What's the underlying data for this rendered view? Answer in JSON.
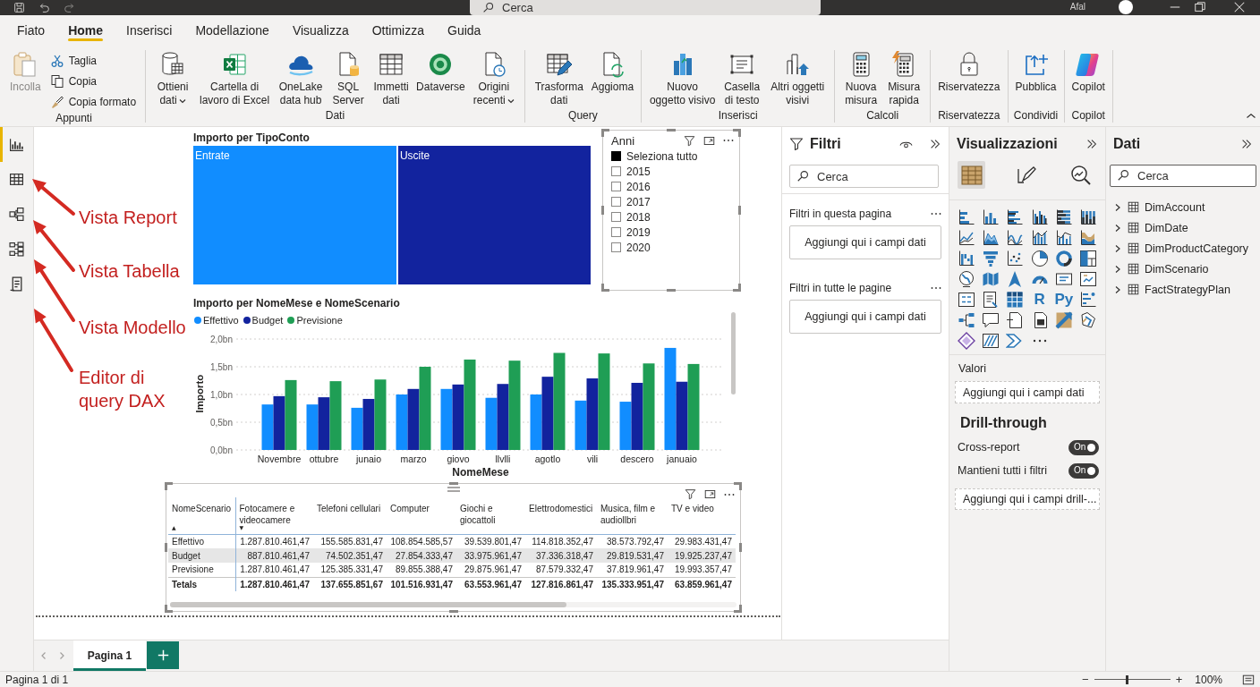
{
  "title_bar": {
    "search_placeholder": "Cerca",
    "user_label": "Afal"
  },
  "menu_tabs": [
    {
      "label": "Fiato",
      "selected": false
    },
    {
      "label": "Home",
      "selected": true
    },
    {
      "label": "Inserisci",
      "selected": false
    },
    {
      "label": "Modellazione",
      "selected": false
    },
    {
      "label": "Visualizza",
      "selected": false
    },
    {
      "label": "Ottimizza",
      "selected": false
    },
    {
      "label": "Guida",
      "selected": false
    }
  ],
  "ribbon": {
    "groups": [
      {
        "label": "Appunti",
        "items": [
          {
            "label": "Incolla",
            "kind": "large",
            "disabled": true
          },
          {
            "label": "Taglia",
            "kind": "small",
            "disabled": false
          },
          {
            "label": "Copia",
            "kind": "small",
            "disabled": false
          },
          {
            "label": "Copia formato",
            "kind": "small",
            "disabled": false
          }
        ]
      },
      {
        "label": "Dati",
        "items": [
          {
            "label": "Ottieni dati",
            "kind": "large",
            "disabled": false,
            "dropdown": true
          },
          {
            "label": "Cartella di lavoro di Excel",
            "kind": "large",
            "disabled": false
          },
          {
            "label": "OneLake data hub",
            "kind": "large",
            "disabled": false
          },
          {
            "label": "SQL Server",
            "kind": "large",
            "disabled": false
          },
          {
            "label": "Immetti dati",
            "kind": "large",
            "disabled": false
          },
          {
            "label": "Dataverse",
            "kind": "large",
            "disabled": false
          },
          {
            "label": "Origini recenti",
            "kind": "large",
            "disabled": false,
            "dropdown": true
          }
        ]
      },
      {
        "label": "Query",
        "items": [
          {
            "label": "Trasforma dati",
            "kind": "large",
            "disabled": false
          },
          {
            "label": "Aggioma",
            "kind": "large",
            "disabled": false
          }
        ]
      },
      {
        "label": "Inserisci",
        "items": [
          {
            "label": "Nuovo oggetto visivo",
            "kind": "large",
            "disabled": false
          },
          {
            "label": "Casella di testo",
            "kind": "large",
            "disabled": false
          },
          {
            "label": "Altri oggetti visivi",
            "kind": "large",
            "disabled": false
          }
        ]
      },
      {
        "label": "Calcoli",
        "items": [
          {
            "label": "Nuova misura",
            "kind": "large",
            "disabled": false
          },
          {
            "label": "Misura rapida",
            "kind": "large",
            "disabled": false
          }
        ]
      },
      {
        "label": "Riservatezza",
        "items": [
          {
            "label": "Riservatezza",
            "kind": "large",
            "disabled": false
          }
        ]
      },
      {
        "label": "Condividi",
        "items": [
          {
            "label": "Pubblica",
            "kind": "large",
            "disabled": false
          }
        ]
      },
      {
        "label": "Copilot",
        "items": [
          {
            "label": "Copilot",
            "kind": "large",
            "disabled": false
          }
        ]
      }
    ]
  },
  "view_rail": [
    {
      "selected": true
    },
    {
      "selected": false
    },
    {
      "selected": false
    },
    {
      "selected": false
    },
    {
      "selected": false
    }
  ],
  "annotations": [
    "Vista Report",
    "Vista Tabella",
    "Vista Modello",
    "Editor di query DAX"
  ],
  "report": {
    "treemap": {
      "title": "Importo per TipoConto",
      "tiles": [
        {
          "label": "Entrate",
          "color": "#118dff"
        },
        {
          "label": "Uscite",
          "color": "#12239e"
        }
      ]
    },
    "slicer": {
      "title": "Anni",
      "selected": true,
      "items": [
        {
          "label": "Seleziona tutto",
          "checked": true
        },
        {
          "label": "2015",
          "checked": false
        },
        {
          "label": "2016",
          "checked": false
        },
        {
          "label": "2017",
          "checked": false
        },
        {
          "label": "2018",
          "checked": false
        },
        {
          "label": "2019",
          "checked": false
        },
        {
          "label": "2020",
          "checked": false
        }
      ]
    },
    "column_chart": {
      "chart_data": {
        "type": "bar",
        "title": "Importo per NomeMese e NomeScenario",
        "xlabel": "NomeMese",
        "ylabel": "Importo",
        "legend": true,
        "grid": true,
        "categories": [
          "Novembre",
          "ottubre",
          "junaio",
          "marzo",
          "giovo",
          "llvlli",
          "agotlo",
          "vili",
          "descero",
          "januaio"
        ],
        "series": [
          {
            "name": "Effettivo",
            "color": "#118dff",
            "values": [
              0.82,
              0.82,
              0.76,
              1.0,
              1.1,
              0.94,
              1.0,
              0.89,
              0.87,
              1.84
            ]
          },
          {
            "name": "Budget",
            "color": "#12239e",
            "values": [
              0.97,
              0.95,
              0.92,
              1.1,
              1.18,
              1.19,
              1.32,
              1.29,
              1.21,
              1.23
            ]
          },
          {
            "name": "Previsione",
            "color": "#1f9e55",
            "values": [
              1.26,
              1.24,
              1.27,
              1.5,
              1.63,
              1.61,
              1.75,
              1.74,
              1.56,
              1.55
            ]
          }
        ],
        "ylim": [
          0,
          2
        ],
        "yticks": [
          {
            "value": 0,
            "label": "0,0bn"
          },
          {
            "value": 0.5,
            "label": "0,5bn"
          },
          {
            "value": 1,
            "label": "1,0bn"
          },
          {
            "value": 1.5,
            "label": "1,5bn"
          },
          {
            "value": 2,
            "label": "2,0bn"
          }
        ]
      }
    },
    "matrix": {
      "selected": true,
      "columns": [
        {
          "label": "NomeScenario",
          "sort_mark": "▲"
        },
        {
          "label": "Fotocamere e videocamere",
          "sort_mark": "▼"
        },
        {
          "label": "Telefoni cellulari"
        },
        {
          "label": "Computer"
        },
        {
          "label": "Giochi e giocattoli"
        },
        {
          "label": "Elettrodomestici"
        },
        {
          "label": "Musica, film e audiollbri"
        },
        {
          "label": "TV e video"
        }
      ],
      "rows": [
        {
          "highlighted": false,
          "cells": [
            "Effettivo",
            "1.287.810.461,47",
            "155.585.831,47",
            "108.854.585,57",
            "39.539.801,47",
            "114.818.352,47",
            "38.573.792,47",
            "29.983.431,47"
          ]
        },
        {
          "highlighted": true,
          "cells": [
            "Budget",
            "887.810.461,47",
            "74.502.351,47",
            "27.854.333,47",
            "33.975.961,47",
            "37.336.318,47",
            "29.819.531,47",
            "19.925.237,47"
          ]
        },
        {
          "highlighted": false,
          "cells": [
            "Previsione",
            "1.287.810.461,47",
            "125.385.331,47",
            "89.855.388,47",
            "29.875.961,47",
            "87.579.332,47",
            "37.819.961,47",
            "19.993.357,47"
          ]
        }
      ],
      "total": {
        "cells": [
          "Tetals",
          "1.287.810.461,47",
          "137.655.851,67",
          "101.516.931,47",
          "63.553.961,47",
          "127.816.861,47",
          "135.333.951,47",
          "63.859.961,47"
        ]
      }
    }
  },
  "filters_pane": {
    "title": "Filtri",
    "search_placeholder": "Cerca",
    "sections": [
      {
        "label": "Filtri in questa pagina",
        "well": "Aggiungi qui i campi dati"
      },
      {
        "label": "Filtri in tutte le pagine",
        "well": "Aggiungi qui i campi dati"
      }
    ]
  },
  "visualizations_pane": {
    "title": "Visualizzazioni",
    "modes": [
      {
        "selected": true
      },
      {
        "selected": false
      },
      {
        "selected": false
      }
    ],
    "gallery_labels": [
      "R",
      "Py"
    ],
    "values_label": "Valori",
    "values_well": "Aggiungi qui i campi dati",
    "drillthrough_title": "Drill-through",
    "toggles": [
      {
        "label": "Cross-report",
        "on": true,
        "text": "On"
      },
      {
        "label": "Mantieni tutti i filtri",
        "on": true,
        "text": "On"
      }
    ],
    "drillthrough_well": "Aggiungi qui i campi drill-..."
  },
  "data_pane": {
    "title": "Dati",
    "search_placeholder": "Cerca",
    "tables": [
      {
        "name": "DimAccount",
        "expanded": false
      },
      {
        "name": "DimDate",
        "expanded": false
      },
      {
        "name": "DimProductCategory",
        "expanded": false
      },
      {
        "name": "DimScenario",
        "expanded": false
      },
      {
        "name": "FactStrategyPlan",
        "expanded": false
      }
    ]
  },
  "page_tabs": [
    {
      "label": "Pagina 1",
      "selected": true
    }
  ],
  "status_bar": {
    "page_info": "Pagina 1 di 1",
    "zoom_out": "−",
    "zoom": {
      "level": 0.43
    },
    "zoom_in": "+",
    "zoom_reading": "100%"
  }
}
